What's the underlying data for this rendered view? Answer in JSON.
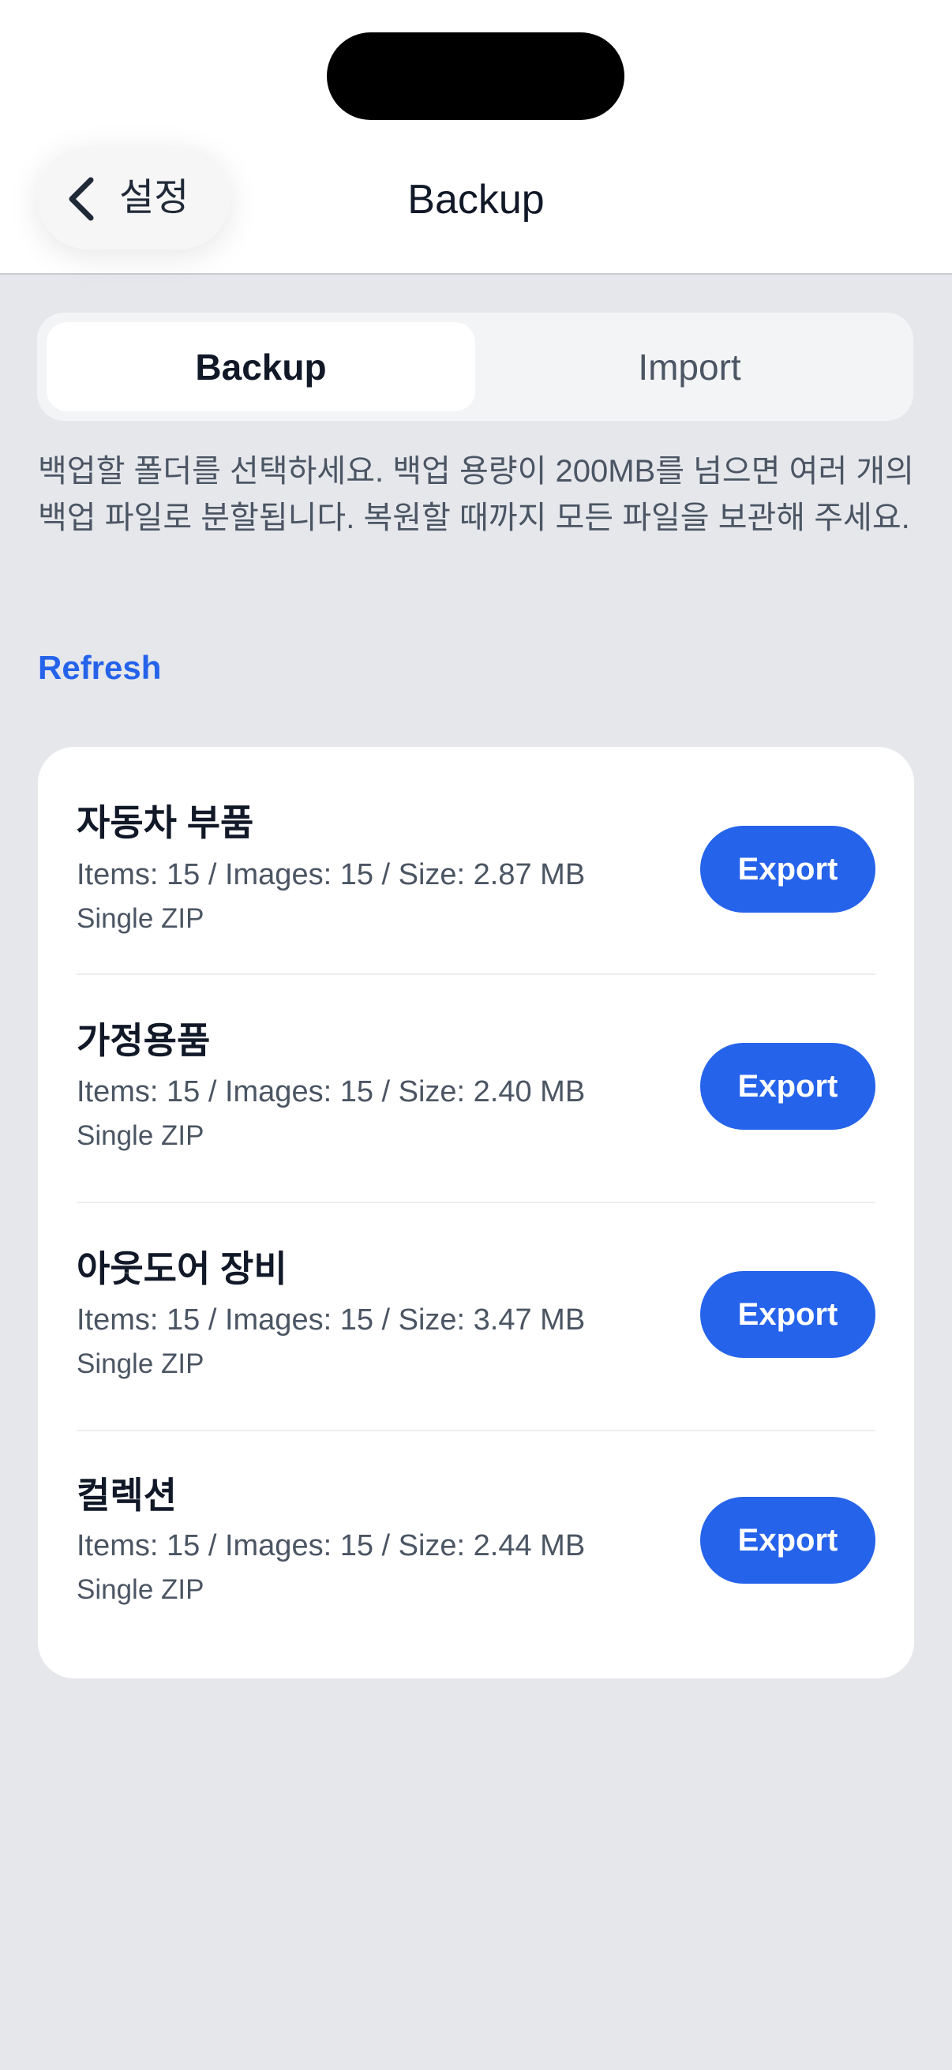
{
  "header": {
    "back_label": "설정",
    "title": "Backup"
  },
  "tabs": [
    {
      "label": "Backup",
      "active": true
    },
    {
      "label": "Import",
      "active": false
    }
  ],
  "description": "백업할 폴더를 선택하세요. 백업 용량이 200MB를 넘으면 여러 개의 백업 파일로 분할됩니다. 복원할 때까지 모든 파일을 보관해 주세요.",
  "refresh_label": "Refresh",
  "folders": [
    {
      "name": "자동차 부품",
      "stats": "Items: 15 / Images: 15 / Size: 2.87 MB",
      "type": "Single ZIP",
      "button": "Export"
    },
    {
      "name": "가정용품",
      "stats": "Items: 15 / Images: 15 / Size: 2.40 MB",
      "type": "Single ZIP",
      "button": "Export"
    },
    {
      "name": "아웃도어 장비",
      "stats": "Items: 15 / Images: 15 / Size: 3.47 MB",
      "type": "Single ZIP",
      "button": "Export"
    },
    {
      "name": "컬렉션",
      "stats": "Items: 15 / Images: 15 / Size: 2.44 MB",
      "type": "Single ZIP",
      "button": "Export"
    }
  ],
  "colors": {
    "accent": "#2563eb",
    "background": "#e5e7eb",
    "card": "#ffffff"
  },
  "icons": {
    "back": "chevron-left-icon"
  }
}
